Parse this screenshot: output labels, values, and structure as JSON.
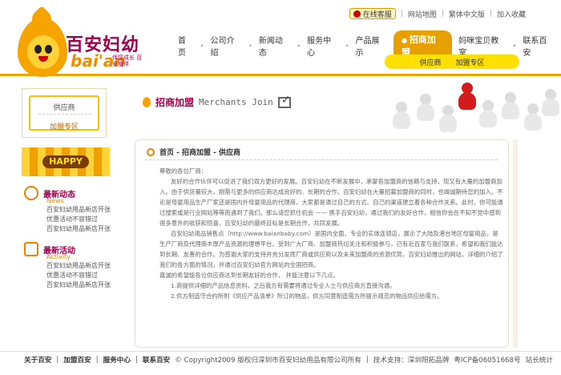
{
  "logo": {
    "cn": "百安妇幼",
    "en": "bai'an",
    "slogan": "伴您成长 百安相伴"
  },
  "topbar": {
    "qq": "在线客服",
    "links": [
      "网站地图",
      "繁体中文版",
      "加入收藏"
    ]
  },
  "nav": {
    "items": [
      "首页",
      "公司介绍",
      "新闻动态",
      "服务中心",
      "产品展示",
      "招商加盟",
      "妈咪宝贝教室",
      "联系百安"
    ],
    "active": "招商加盟",
    "sub": [
      "供应商",
      "加盟专区"
    ]
  },
  "sidebar": {
    "box": {
      "l1": "供应商",
      "l2": "加盟专区"
    },
    "happy": "HAPPY",
    "news": [
      {
        "title": "最新动态",
        "sub": "News",
        "items": [
          "百安妇幼用品新店开张",
          "优惠活动不容错过",
          "百安妇幼用品新店开张"
        ]
      },
      {
        "title": "最新活动",
        "sub": "Activity",
        "items": [
          "百安妇幼用品新店开张",
          "优惠活动不容错过",
          "百安妇幼用品新店开张"
        ]
      }
    ]
  },
  "banner": {
    "cn": "招商加盟",
    "en": "Merchants Join"
  },
  "main": {
    "crumb": "首页 - 招商加盟 - 供应商",
    "paras": [
      "尊敬的各位厂商：",
      "友好的合作伙伴可以促进了我们双方更好的发展。百安妇幼在不断发展中，承蒙各加盟商的信赖与支持，现又有大量的加盟商加入。由于供货量较大，刚需与更多的供应商达成良好的、长期的合作。百安妇幼在大量招募加盟商的同时，也竭诚期待您的加入。不论是母婴用品生产厂家还是国内外母婴用品的代理商，大家都是通过自己的方式、自己的渠道建立着各种合作关系。此时，你可能通过搜索或是行业网站等等而遇到了我们。那么请您抓住机会 —— 携手百安妇幼，通过我们的友好合作，相信你会在不知不觉中感到很多意外的收获和惊喜，百安妇幼的最终目标是长期合作，共同发展。",
      "百安妇幼用品销售点（http://www.baianbaby.com）是国内全面、专业的实体连锁店，展示了大陆及港台地区母婴用品，是生产厂商及代理商丰厚产品资源的理想平台。受到广大厂商、加盟商热切关注和积极参与，已有近百家与我们联系，希望和我们能达到长期、友善的合作。为感谢大家的支持并充分发挥厂商或供应商以及未来加盟商的资源优势，百安妇幼推出的网站，详细的介绍了我们的各方面的情况，并通过百安妇幼官方网站向全国招商。",
      "真诚的希望能各位供应商达到长期友好的合作， 并能注意以下几点。",
      "1.商提供详细的产品信息资料，之后我方有需要将通过专业人士与供应商方直接沟通。",
      "2.供方制造守合约所附《供应产品清单》所订的物品，供方同意制造需方所提示规范的物品供应给需方。"
    ]
  },
  "footer": {
    "links": [
      "关于百安",
      "加盟百安",
      "服务中心",
      "联系百安"
    ],
    "copyright": "© Copyright2009 版权归深圳市百安妇幼用品有限公司所有",
    "tech": "技术支持：深圳阳拓品牌",
    "icp": "粤ICP备06051668号",
    "stats": "站长统计"
  }
}
